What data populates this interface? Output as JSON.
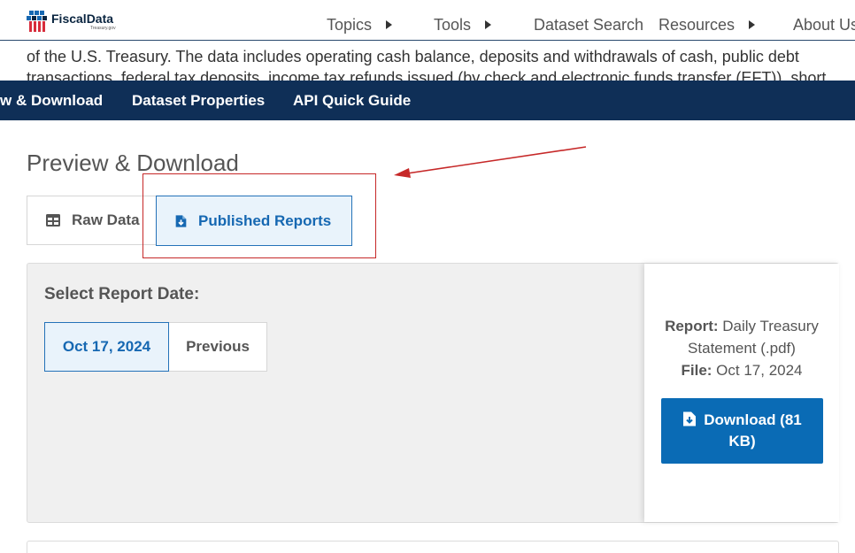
{
  "header": {
    "logo_text": "FiscalData",
    "logo_subtext": "Treasury.gov",
    "nav": [
      {
        "label": "Topics",
        "has_menu": true
      },
      {
        "label": "Tools",
        "has_menu": true
      },
      {
        "label": "Dataset Search",
        "has_menu": false
      },
      {
        "label": "Resources",
        "has_menu": true
      },
      {
        "label": "About Us",
        "has_menu": false
      }
    ]
  },
  "description": "of the U.S. Treasury. The data includes operating cash balance, deposits and withdrawals of cash, public debt transactions, federal tax deposits, income tax refunds issued (by check and electronic funds transfer (EFT)), short",
  "section_nav": {
    "items": [
      "w & Download",
      "Dataset Properties",
      "API Quick Guide"
    ]
  },
  "preview": {
    "title": "Preview & Download",
    "tabs": {
      "raw_data": "Raw Data",
      "published_reports": "Published Reports"
    },
    "select_report_label": "Select Report Date:",
    "dates": {
      "current": "Oct 17, 2024",
      "previous": "Previous"
    },
    "report": {
      "report_label": "Report:",
      "report_name": "Daily Treasury Statement (.pdf)",
      "file_label": "File:",
      "file_date": "Oct 17, 2024",
      "download_label": "Download (81 KB)"
    }
  },
  "colors": {
    "navy": "#0f2f57",
    "accent_blue": "#0a6bb5",
    "active_tab_bg": "#e9f3fb",
    "annotation_red": "#c62828"
  },
  "icons": {
    "logo": "fiscaldata-flag-logo",
    "menu_caret": "caret-right-icon",
    "raw_data": "table-icon",
    "published_reports": "file-download-icon",
    "download": "file-download-icon"
  }
}
